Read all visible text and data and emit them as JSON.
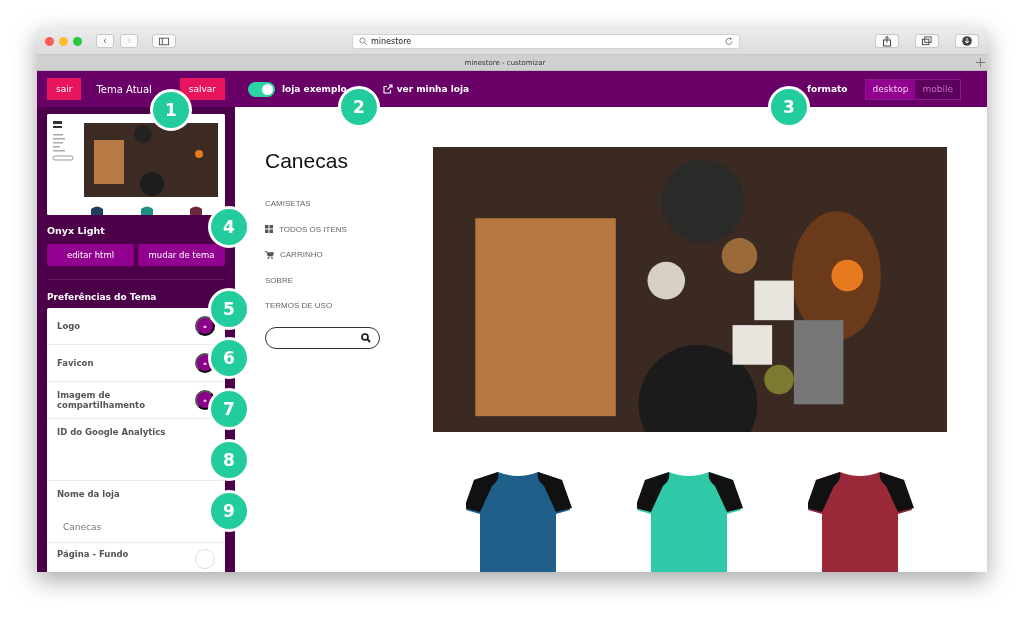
{
  "browser": {
    "address": "minestore",
    "tab_title": "minestore - customizar"
  },
  "topbar": {
    "exit_button": "sair",
    "current_theme_label": "Tema Atual",
    "save_button": "salvar",
    "sample_toggle": {
      "label": "loja exemplo",
      "on": true
    },
    "view_store_link": "ver minha loja",
    "format_label": "formato",
    "formats": [
      {
        "label": "desktop",
        "selected": true
      },
      {
        "label": "mobile",
        "selected": false
      }
    ]
  },
  "sidebar": {
    "theme_name": "Onyx Light",
    "theme_buttons": [
      "editar html",
      "mudar de tema"
    ],
    "preferences_title": "Preferências do Tema",
    "preferences": [
      {
        "kind": "upload",
        "label": "Logo"
      },
      {
        "kind": "upload",
        "label": "Favicon"
      },
      {
        "kind": "upload",
        "label": "Imagem de compartilhamento"
      },
      {
        "kind": "text",
        "label": "ID do Google Analytics"
      },
      {
        "kind": "text",
        "label": "Nome da loja",
        "value": "Canecas"
      },
      {
        "kind": "color",
        "label": "Página - Fundo"
      }
    ]
  },
  "store": {
    "title": "Canecas",
    "nav": [
      {
        "label": "CAMISETAS",
        "kind": "plain"
      },
      {
        "label": "TODOS OS ITENS",
        "kind": "grid"
      },
      {
        "label": "CARRINHO",
        "kind": "cart"
      },
      {
        "label": "SOBRE",
        "kind": "plain"
      },
      {
        "label": "TERMOS DE USO",
        "kind": "plain"
      }
    ],
    "products": [
      {
        "color": "#1f5f8a"
      },
      {
        "color": "#2fc9a8"
      },
      {
        "color": "#9a2a3a"
      }
    ]
  },
  "callouts": [
    "1",
    "2",
    "3",
    "4",
    "5",
    "6",
    "7",
    "8",
    "9"
  ]
}
